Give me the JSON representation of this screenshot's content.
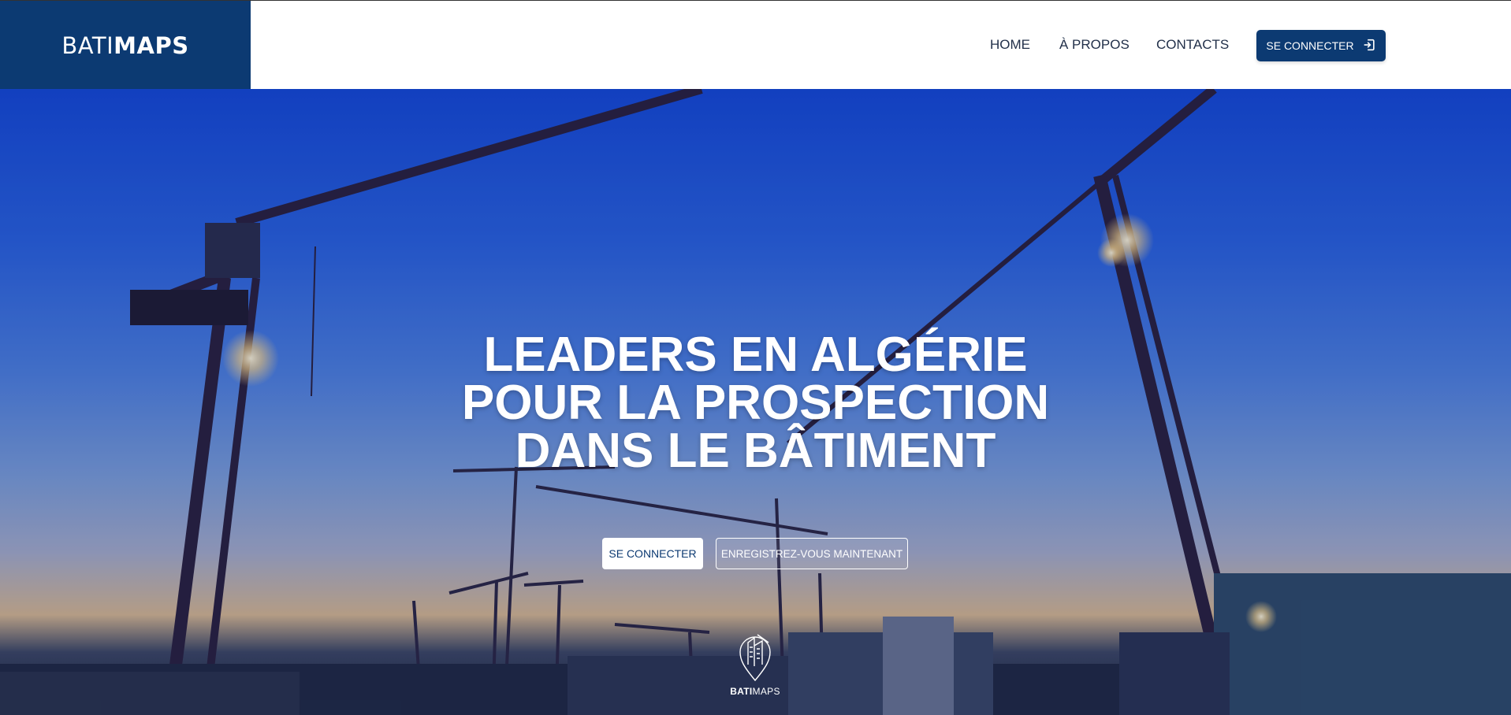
{
  "brand": {
    "part1": "BATI",
    "part2": "MAPS"
  },
  "nav": {
    "home": "HOME",
    "about": "À PROPOS",
    "contacts": "CONTACTS",
    "login": "SE CONNECTER",
    "login_icon": "login-icon"
  },
  "hero": {
    "headline": [
      "LEADERS EN ALGÉRIE",
      "POUR LA PROSPECTION",
      "DANS LE BÂTIMENT"
    ],
    "login_button": "SE CONNECTER",
    "register_button": "ENREGISTREZ-VOUS MAINTENANT",
    "logo": {
      "part1": "BATI",
      "part2": "MAPS",
      "icon": "building-pin-icon"
    }
  },
  "colors": {
    "brand": "#0c3a72",
    "text_nav": "#22304a"
  }
}
